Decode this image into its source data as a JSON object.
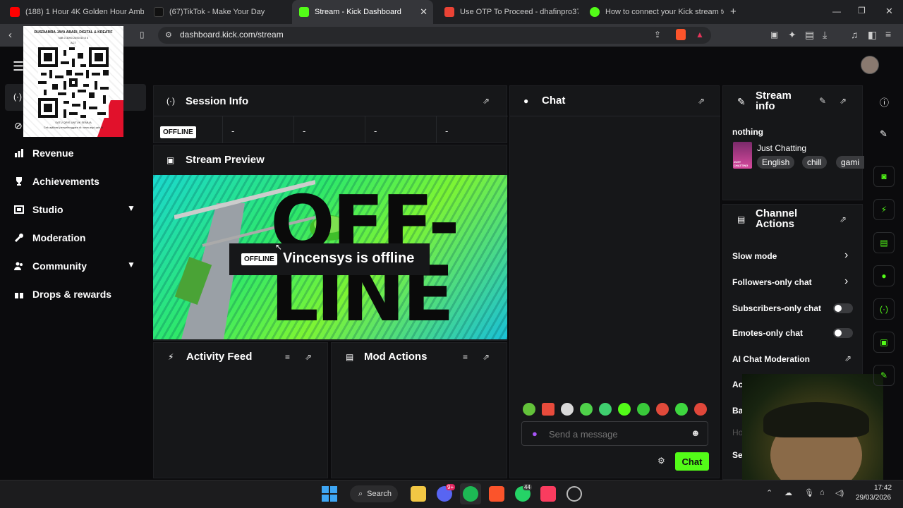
{
  "browser": {
    "tabs": [
      {
        "title": "(188) 1 Hour 4K Golden Hour Ambie"
      },
      {
        "title": "(67)TikTok - Make Your Day"
      },
      {
        "title": "Stream - Kick Dashboard"
      },
      {
        "title": "Use OTP To Proceed - dhafinpro37@"
      },
      {
        "title": "How to connect your Kick stream to"
      }
    ],
    "new_tab": "+",
    "url": "dashboard.kick.com/stream"
  },
  "qr_overlay": {
    "org": "RUSDIAMRA JAYA ABADI, DIGITAL & KREATIF",
    "line1": "NIB 0 3090 2490 60 8 0",
    "line2": "ACT",
    "footer1": "SATU QRIS UNTUK SEMUA",
    "footer2": "Cek aplikasi penyelenggara di: www.aspi-qris.id"
  },
  "sidebar": {
    "items": [
      {
        "label": "Revenue",
        "icon": "revenue-icon"
      },
      {
        "label": "Achievements",
        "icon": "trophy-icon"
      },
      {
        "label": "Studio",
        "icon": "studio-icon"
      },
      {
        "label": "Moderation",
        "icon": "wrench-icon"
      },
      {
        "label": "Community",
        "icon": "community-icon"
      },
      {
        "label": "Drops & rewards",
        "icon": "gift-icon"
      }
    ]
  },
  "session_info": {
    "title": "Session Info",
    "status": "OFFLINE",
    "stats": [
      "-",
      "-",
      "-",
      "-"
    ]
  },
  "stream_preview": {
    "title": "Stream Preview",
    "thumbnail_text": "OFF-LINE",
    "badge": "OFFLINE",
    "message": "Vincensys is offline"
  },
  "activity_feed": {
    "title": "Activity Feed"
  },
  "mod_actions": {
    "title": "Mod Actions"
  },
  "chat": {
    "title": "Chat",
    "placeholder": "Send a message",
    "send_label": "Chat"
  },
  "stream_info": {
    "title": "Stream info",
    "stream_title": "nothing",
    "category": "Just Chatting",
    "category_thumb": "JUST CHATTING",
    "tags": [
      "English",
      "chill",
      "gami"
    ]
  },
  "channel_actions": {
    "title": "Channel Actions",
    "slow_mode": "Slow mode",
    "followers_only": "Followers-only chat",
    "subscribers_only": "Subscribers-only chat",
    "emotes_only": "Emotes-only chat",
    "ai_moderation": "AI Chat Moderation",
    "partial": [
      "Ac",
      "Ba",
      "Ho",
      "Se"
    ]
  },
  "taskbar": {
    "search": "Search",
    "time": "17:42",
    "date": "29/03/2026",
    "badge1": "9+",
    "badge2": "44"
  },
  "colors": {
    "accent": "#53fc18",
    "panel": "#161719",
    "bg": "#0b0b0d"
  }
}
